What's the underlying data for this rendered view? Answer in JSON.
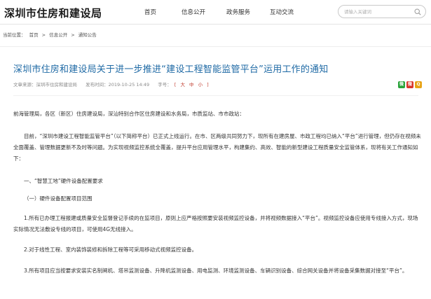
{
  "header": {
    "logo": "深圳市住房和建设局",
    "nav": [
      {
        "label": "首页",
        "name": "nav-home"
      },
      {
        "label": "信息公开",
        "name": "nav-info-public"
      },
      {
        "label": "政务服务",
        "name": "nav-gov-service"
      },
      {
        "label": "互动交流",
        "name": "nav-interaction"
      }
    ],
    "search": {
      "placeholder": "请输入关键词",
      "icon": "search-icon"
    }
  },
  "breadcrumb": {
    "prefix": "当前位置：",
    "items": [
      "首页",
      "信息公开",
      "通知公告"
    ],
    "separator": ">"
  },
  "article": {
    "title": "深圳市住房和建设局关于进一步推进“建设工程智能监管平台”运用工作的通知",
    "meta": {
      "source": "文章来源：深圳市住房和建设局",
      "published": "发布时间：2019-10-25 14:49",
      "font_label": "字号：",
      "font_sizes": [
        "大",
        "中",
        "小"
      ],
      "bracket_open": "[",
      "bracket_close": "]"
    },
    "share_icons": [
      {
        "name": "share-weixin-icon",
        "color": "#2aa33a",
        "glyph": "微"
      },
      {
        "name": "share-weibo-icon",
        "color": "#d9362b",
        "glyph": "微"
      },
      {
        "name": "share-qzone-icon",
        "color": "#e8a417",
        "glyph": "Q"
      }
    ],
    "paragraphs": [
      "前海管理局，各区（新区）住房建设局，深汕特别合作区住房建设和水务局，市质监站、市市政站：",
      "目前，“深圳市建设工程智能监管平台”（以下简称平台）已正式上线运行。在市、区两级共同努力下，现所有在建房屋、市政工程均已纳入“平台”进行管理，但仍存在视频未全面覆盖、管理数据更新不及时等问题。为实现视频监控系统全覆盖，提升平台应用管理水平，构建集约、高效、智能的新型建设工程质量安全监管体系，现将有关工作通知如下：",
      "一、“智慧工地”硬件设备配置要求",
      "（一）硬件设备配置项目范围",
      "1.所有已办理工程报建或质量安全监督登记手续的在监项目，原则上应严格按照要安装视频监控设备，并将视频数据接入“平台”。视频监控设备应使用专线接入方式，现场实际情况无法敷设专线的项目，可使用4G无线接入。",
      "2.对于线性工程、室内装饰装修和拆除工程等可采用移动式视频监控设备。",
      "3.所有项目应当按要求安装实名制闸机、塔吊监测设备、升降机监测设备、用电监测、环境监测设备、车辆识别设备、综合网关设备并将设备采集数据对接至“平台”。"
    ]
  }
}
